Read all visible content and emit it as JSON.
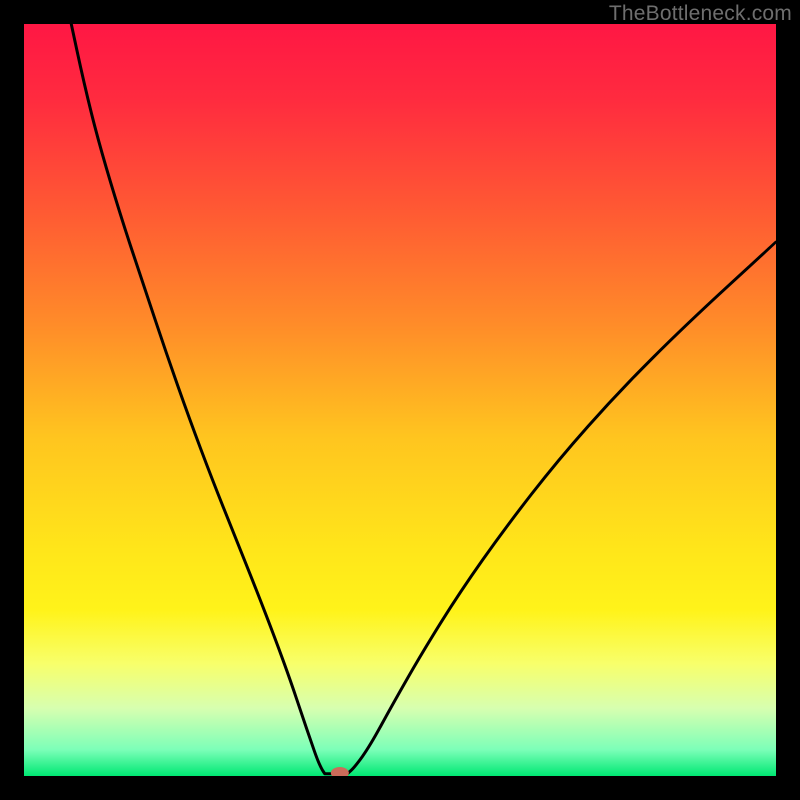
{
  "watermark": "TheBottleneck.com",
  "chart_data": {
    "type": "line",
    "title": "",
    "xlabel": "",
    "ylabel": "",
    "xlim": [
      0,
      100
    ],
    "ylim": [
      0,
      100
    ],
    "gradient_stops": [
      {
        "offset": 0.0,
        "color": "#ff1744"
      },
      {
        "offset": 0.1,
        "color": "#ff2b3f"
      },
      {
        "offset": 0.25,
        "color": "#ff5a33"
      },
      {
        "offset": 0.4,
        "color": "#ff8c29"
      },
      {
        "offset": 0.55,
        "color": "#ffc51f"
      },
      {
        "offset": 0.7,
        "color": "#ffe61a"
      },
      {
        "offset": 0.78,
        "color": "#fff31a"
      },
      {
        "offset": 0.85,
        "color": "#f8ff6a"
      },
      {
        "offset": 0.91,
        "color": "#d7ffb0"
      },
      {
        "offset": 0.965,
        "color": "#7cffb8"
      },
      {
        "offset": 1.0,
        "color": "#00e873"
      }
    ],
    "curve_left": {
      "x": [
        6,
        8,
        10,
        13,
        16,
        19,
        22,
        25,
        28,
        31,
        33.5,
        35.5,
        37,
        38.2,
        39,
        39.6,
        40
      ],
      "y": [
        100,
        92,
        84,
        74,
        65,
        56,
        47.5,
        39.5,
        32,
        24.5,
        18,
        12.5,
        8,
        4.5,
        2.2,
        0.9,
        0.3
      ]
    },
    "curve_right": {
      "x": [
        43,
        44,
        46,
        49,
        53,
        58,
        64,
        71,
        79,
        88,
        100
      ],
      "y": [
        0.3,
        1.2,
        4,
        9.5,
        16.5,
        24.5,
        33,
        42,
        51,
        60,
        71
      ]
    },
    "flat_segment": {
      "x_start": 40,
      "x_end": 43,
      "y": 0.3
    },
    "marker": {
      "x": 42.0,
      "y": 0.4,
      "color": "#cc6b5a",
      "rx": 9,
      "ry": 6
    },
    "series": [
      {
        "name": "curve",
        "x": [
          6,
          40,
          43,
          100
        ],
        "y_note": "see curve_left, flat_segment, curve_right"
      }
    ]
  }
}
